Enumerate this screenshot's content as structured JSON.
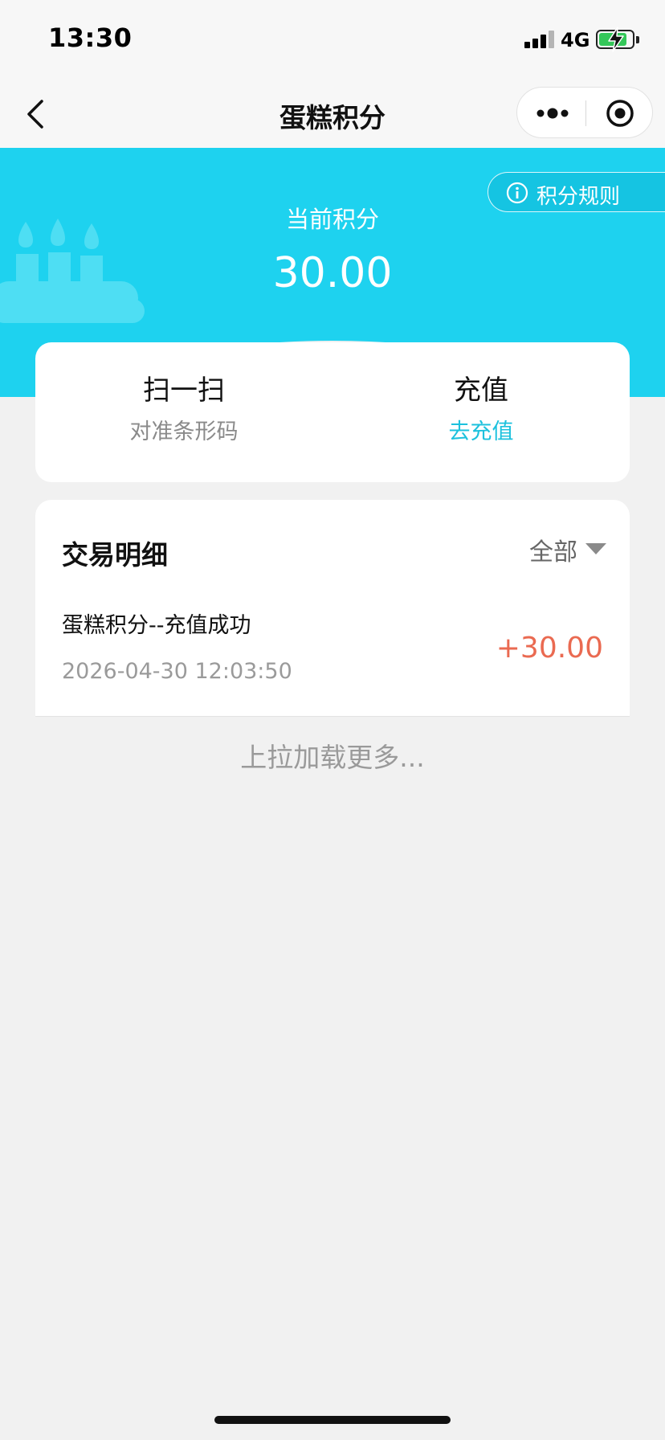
{
  "status_bar": {
    "time": "13:30",
    "network": "4G",
    "battery_level": 0.85,
    "battery_color": "#34c759"
  },
  "nav": {
    "title": "蛋糕积分",
    "icons": [
      "chevron-left-icon",
      "more-dots-icon",
      "target-icon"
    ]
  },
  "hero": {
    "label": "当前积分",
    "points": "30.00",
    "rules_label": "积分规则",
    "background_color": "#1ed2ef"
  },
  "actions": {
    "scan": {
      "title": "扫一扫",
      "subtitle": "对准条形码"
    },
    "recharge": {
      "title": "充值",
      "subtitle": "去充值"
    },
    "link_color": "#1cc1dd"
  },
  "transactions": {
    "title": "交易明细",
    "filter_label": "全部",
    "items": [
      {
        "description": "蛋糕积分--充值成功",
        "time": "2026-04-30 12:03:50",
        "amount": "+30.00"
      }
    ],
    "amount_color": "#ea6a51"
  },
  "load_more": "上拉加载更多..."
}
